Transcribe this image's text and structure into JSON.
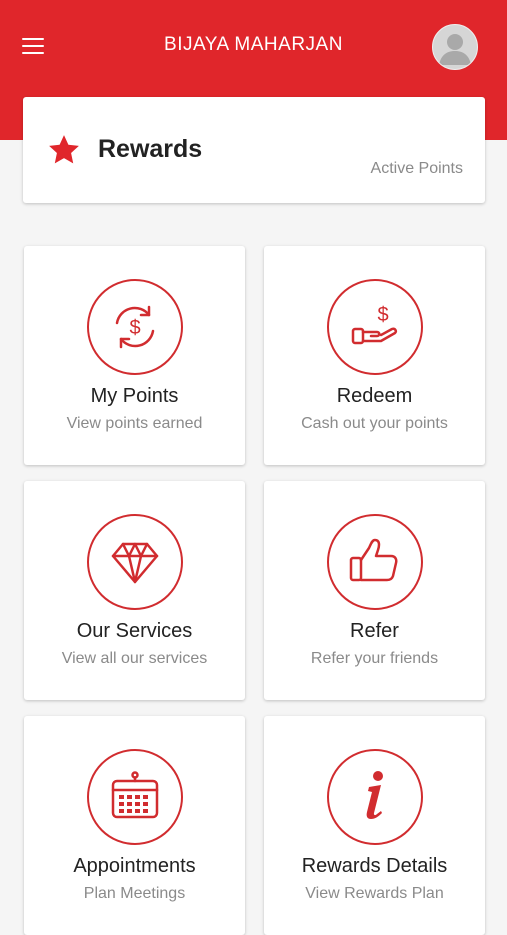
{
  "header": {
    "title": "BIJAYA MAHARJAN",
    "menu_icon": "hamburger-menu-icon",
    "avatar_icon": "user-avatar-icon",
    "background_color": "#e0262b"
  },
  "rewards": {
    "title": "Rewards",
    "subtitle": "Active Points",
    "icon": "star-icon",
    "accent_color": "#e0262b"
  },
  "tiles": [
    {
      "title": "My Points",
      "subtitle": "View points earned",
      "icon": "currency-exchange-icon"
    },
    {
      "title": "Redeem",
      "subtitle": "Cash out your points",
      "icon": "hand-dollar-icon"
    },
    {
      "title": "Our Services",
      "subtitle": "View all our services",
      "icon": "diamond-icon"
    },
    {
      "title": "Refer",
      "subtitle": "Refer your friends",
      "icon": "thumbs-up-icon"
    },
    {
      "title": "Appointments",
      "subtitle": "Plan Meetings",
      "icon": "calendar-icon"
    },
    {
      "title": "Rewards Details",
      "subtitle": "View Rewards Plan",
      "icon": "info-icon"
    }
  ]
}
